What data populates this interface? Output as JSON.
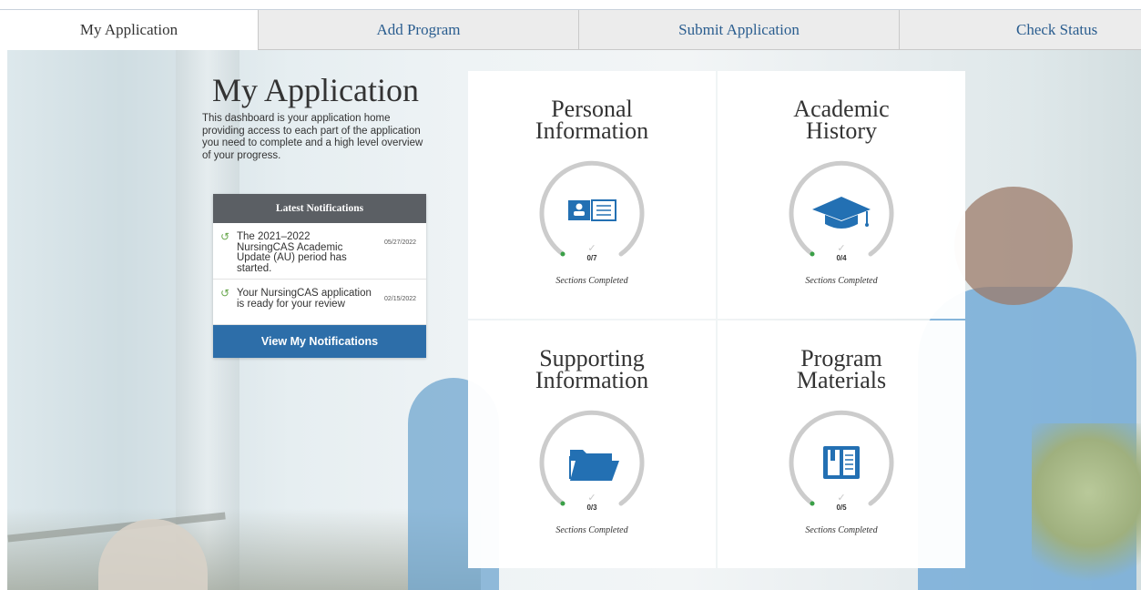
{
  "tabs": [
    {
      "label": "My Application",
      "active": true
    },
    {
      "label": "Add Program",
      "active": false
    },
    {
      "label": "Submit Application",
      "active": false
    },
    {
      "label": "Check Status",
      "active": false
    }
  ],
  "intro": {
    "title": "My Application",
    "text": "This dashboard is your application home providing access to each part of the application you need to complete and a high level overview of your progress."
  },
  "notifications": {
    "header": "Latest Notifications",
    "items": [
      {
        "text": "The 2021–2022 NursingCAS Academic Update (AU) period has started.",
        "date": "05/27/2022"
      },
      {
        "text": "Your NursingCAS application is ready for your review",
        "date": "02/15/2022"
      }
    ],
    "button_label": "View My Notifications"
  },
  "cards": [
    {
      "title": "Personal Information",
      "count": "0/7",
      "completed": 0,
      "total": 7,
      "label": "Sections Completed",
      "icon": "id-card-icon"
    },
    {
      "title": "Academic History",
      "count": "0/4",
      "completed": 0,
      "total": 4,
      "label": "Sections Completed",
      "icon": "graduation-cap-icon"
    },
    {
      "title": "Supporting Information",
      "count": "0/3",
      "completed": 0,
      "total": 3,
      "label": "Sections Completed",
      "icon": "folder-icon"
    },
    {
      "title": "Program Materials",
      "count": "0/5",
      "completed": 0,
      "total": 5,
      "label": "Sections Completed",
      "icon": "book-icon"
    }
  ],
  "colors": {
    "accent": "#2d6ea9",
    "notif_header": "#5b5f64",
    "icon_blue": "#2370b3",
    "progress_green": "#3aa047",
    "ring_gray": "#cccccc"
  }
}
